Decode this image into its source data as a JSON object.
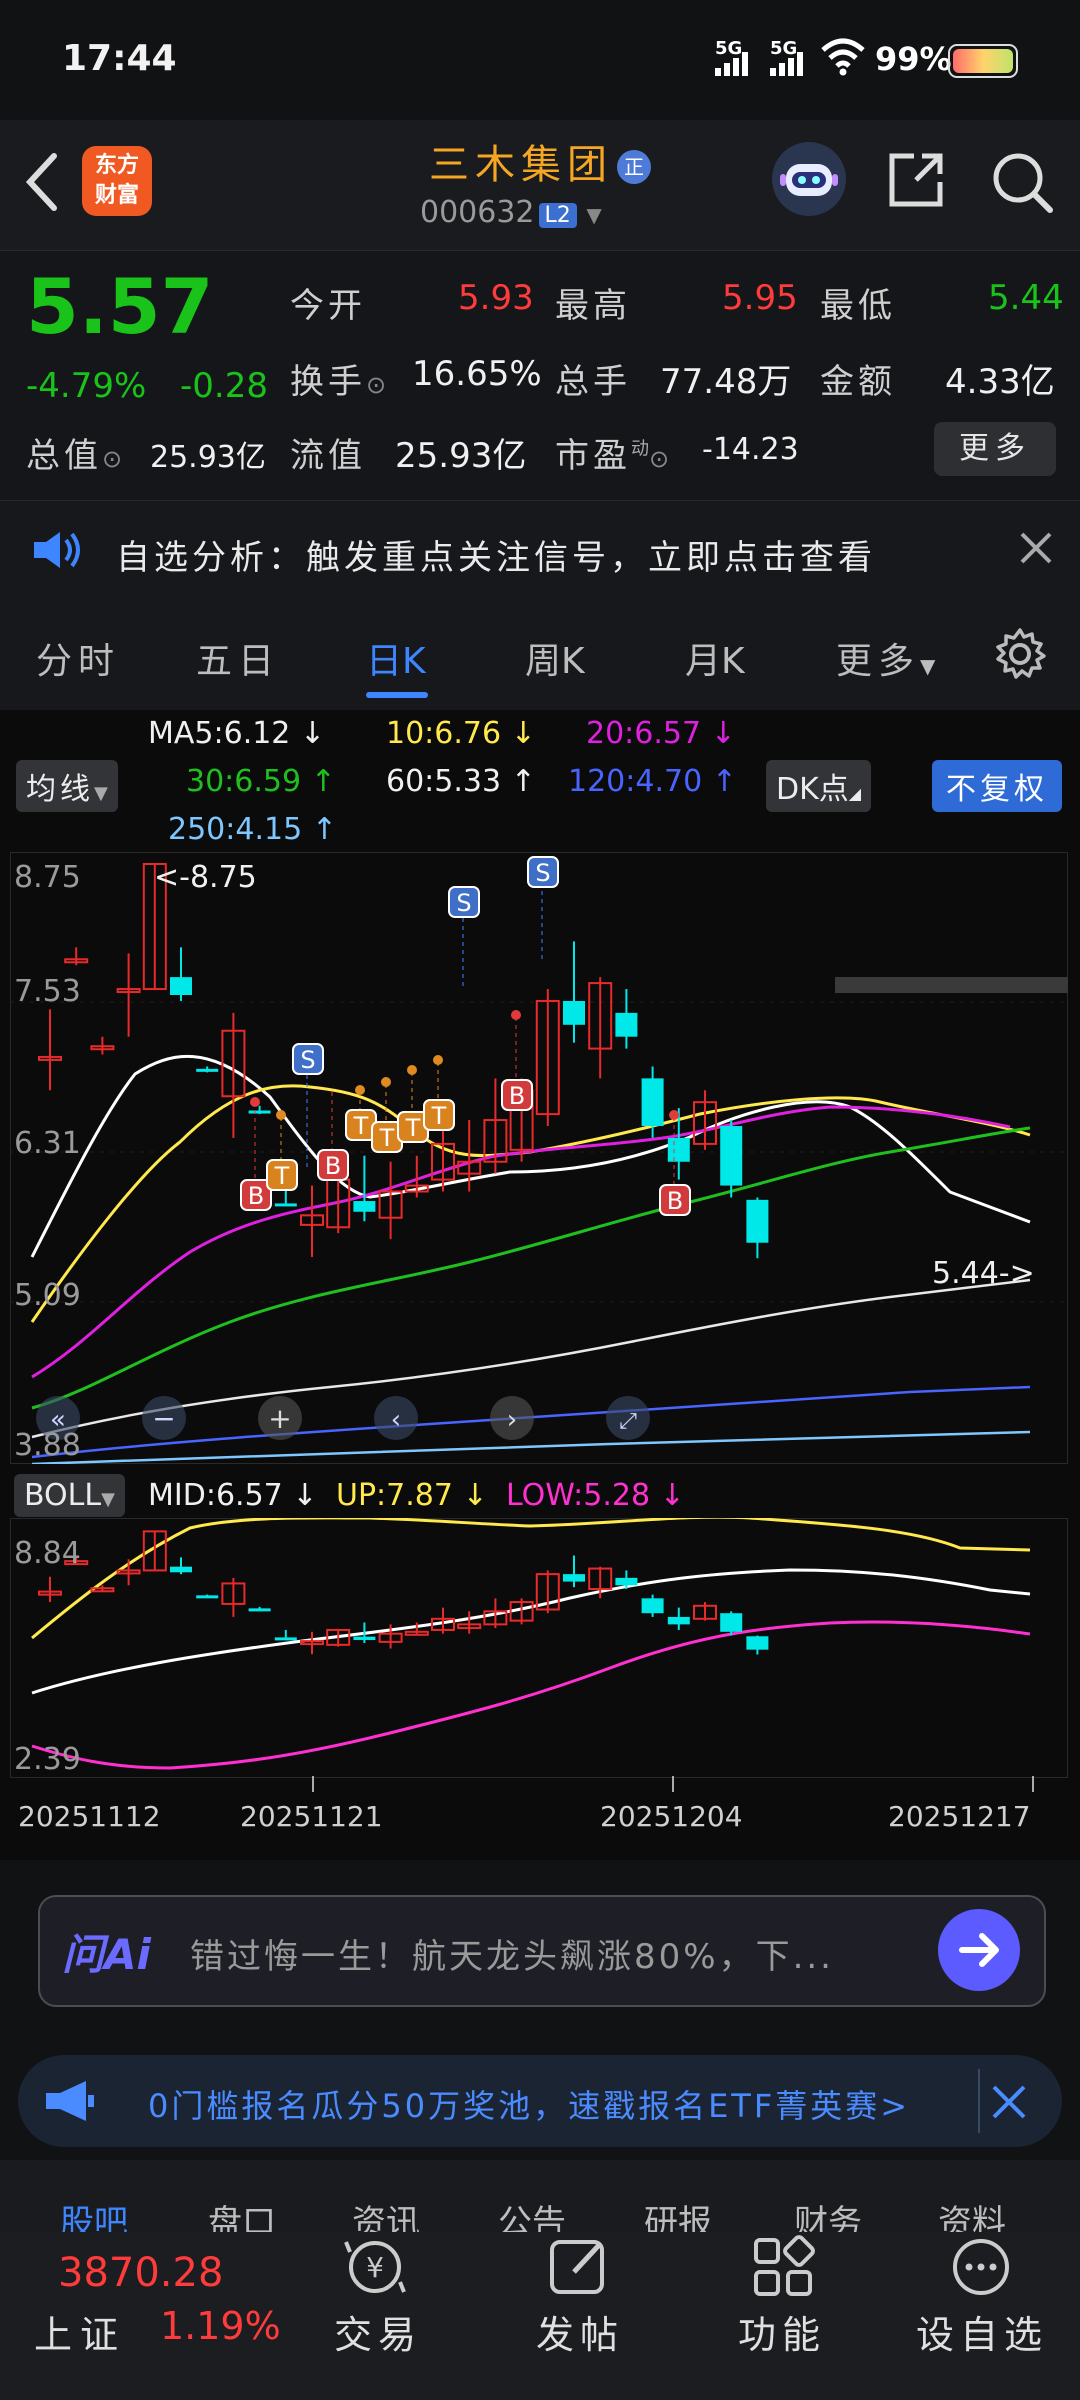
{
  "status_bar": {
    "time": "17:44",
    "signal1": "5G",
    "signal2": "5G",
    "battery": "99%"
  },
  "header": {
    "logo_line1": "东方",
    "logo_line2": "财富",
    "stock_name": "三木集团",
    "name_badge": "正",
    "stock_code": "000632",
    "level_badge": "L2"
  },
  "quote": {
    "price": "5.57",
    "change_pct": "-4.79%",
    "change_amt": "-0.28",
    "open_label": "今开",
    "open": "5.93",
    "high_label": "最高",
    "high": "5.95",
    "low_label": "最低",
    "low": "5.44",
    "turnover_label": "换手",
    "turnover": "16.65%",
    "volume_label": "总手",
    "volume": "77.48万",
    "amount_label": "金额",
    "amount": "4.33亿",
    "mktcap_label": "总值",
    "mktcap": "25.93亿",
    "float_label": "流值",
    "float": "25.93亿",
    "pe_label": "市盈",
    "pe_sup": "动",
    "pe": "-14.23",
    "more_button": "更多"
  },
  "notice": {
    "text": "自选分析：触发重点关注信号，立即点击查看"
  },
  "tabs": [
    {
      "label": "分时",
      "active": false
    },
    {
      "label": "五日",
      "active": false
    },
    {
      "label": "日K",
      "active": true
    },
    {
      "label": "周K",
      "active": false
    },
    {
      "label": "月K",
      "active": false
    },
    {
      "label": "更多",
      "active": false
    }
  ],
  "ma": {
    "selector": "均线",
    "ma5": "MA5:6.12 ↓",
    "ma10": "10:6.76 ↓",
    "ma20": "20:6.57 ↓",
    "ma30": "30:6.59 ↑",
    "ma60": "60:5.33 ↑",
    "ma120": "120:4.70 ↑",
    "ma250": "250:4.15 ↑",
    "dk_button": "DK点",
    "fq_button": "不复权"
  },
  "chart_labels": {
    "y_top": "8.75",
    "y_2": "7.53",
    "y_3": "6.31",
    "y_4": "5.09",
    "y_bottom": "3.88",
    "max_marker": "<-8.75",
    "min_marker": "5.44->"
  },
  "boll": {
    "selector": "BOLL",
    "mid": "MID:6.57 ↓",
    "up": "UP:7.87 ↓",
    "low": "LOW:5.28 ↓",
    "y_top": "8.84",
    "y_bottom": "2.39"
  },
  "x_axis": {
    "d1": "20251112",
    "d2": "20251121",
    "d3": "20251204",
    "d4": "20251217"
  },
  "chart_data": {
    "type": "candlestick",
    "title": "",
    "ylim": [
      3.88,
      8.75
    ],
    "candles": [
      {
        "o": 7.13,
        "c": 7.13,
        "h": 7.53,
        "l": 6.85,
        "dir": "up"
      },
      {
        "o": 7.95,
        "c": 7.95,
        "h": 8.05,
        "l": 7.9,
        "dir": "up"
      },
      {
        "o": 7.22,
        "c": 7.22,
        "h": 7.3,
        "l": 7.15,
        "dir": "up"
      },
      {
        "o": 7.7,
        "c": 7.7,
        "h": 8.0,
        "l": 7.3,
        "dir": "up"
      },
      {
        "o": 7.7,
        "c": 8.75,
        "h": 8.75,
        "l": 7.7,
        "dir": "up"
      },
      {
        "o": 7.8,
        "c": 7.65,
        "h": 8.05,
        "l": 7.6,
        "dir": "down"
      },
      {
        "o": 7.03,
        "c": 7.03,
        "h": 7.05,
        "l": 7.0,
        "dir": "down"
      },
      {
        "o": 6.8,
        "c": 7.35,
        "h": 7.5,
        "l": 6.45,
        "dir": "up"
      },
      {
        "o": 6.68,
        "c": 6.68,
        "h": 6.72,
        "l": 6.65,
        "dir": "down"
      },
      {
        "o": 5.9,
        "c": 5.9,
        "h": 6.1,
        "l": 5.9,
        "dir": "down"
      },
      {
        "o": 5.72,
        "c": 5.8,
        "h": 6.05,
        "l": 5.45,
        "dir": "up"
      },
      {
        "o": 5.7,
        "c": 6.1,
        "h": 6.1,
        "l": 5.65,
        "dir": "up"
      },
      {
        "o": 5.83,
        "c": 5.92,
        "h": 6.3,
        "l": 5.75,
        "dir": "down"
      },
      {
        "o": 5.78,
        "c": 6.0,
        "h": 6.25,
        "l": 5.6,
        "dir": "up"
      },
      {
        "o": 6.0,
        "c": 6.05,
        "h": 6.3,
        "l": 5.95,
        "dir": "up"
      },
      {
        "o": 6.1,
        "c": 6.4,
        "h": 6.7,
        "l": 6.0,
        "dir": "up"
      },
      {
        "o": 6.15,
        "c": 6.25,
        "h": 6.6,
        "l": 6.0,
        "dir": "up"
      },
      {
        "o": 6.25,
        "c": 6.6,
        "h": 6.95,
        "l": 6.15,
        "dir": "up"
      },
      {
        "o": 6.35,
        "c": 6.85,
        "h": 6.95,
        "l": 6.25,
        "dir": "up"
      },
      {
        "o": 6.65,
        "c": 7.6,
        "h": 7.7,
        "l": 6.55,
        "dir": "up"
      },
      {
        "o": 7.6,
        "c": 7.4,
        "h": 8.1,
        "l": 7.25,
        "dir": "down"
      },
      {
        "o": 7.2,
        "c": 7.75,
        "h": 7.8,
        "l": 6.95,
        "dir": "up"
      },
      {
        "o": 7.5,
        "c": 7.3,
        "h": 7.7,
        "l": 7.2,
        "dir": "down"
      },
      {
        "o": 6.95,
        "c": 6.55,
        "h": 7.05,
        "l": 6.45,
        "dir": "down"
      },
      {
        "o": 6.45,
        "c": 6.25,
        "h": 6.7,
        "l": 6.1,
        "dir": "down"
      },
      {
        "o": 6.4,
        "c": 6.75,
        "h": 6.85,
        "l": 6.35,
        "dir": "up"
      },
      {
        "o": 6.55,
        "c": 6.05,
        "h": 6.6,
        "l": 5.95,
        "dir": "down"
      },
      {
        "o": 5.93,
        "c": 5.57,
        "h": 5.95,
        "l": 5.44,
        "dir": "down"
      }
    ]
  }
}
